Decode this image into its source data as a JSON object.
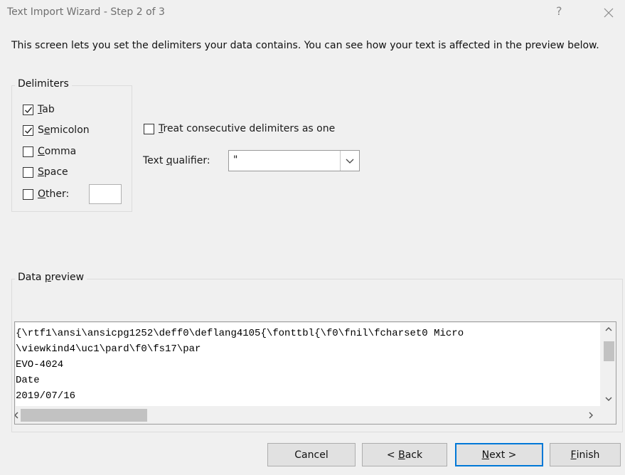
{
  "window": {
    "title": "Text Import Wizard - Step 2 of 3",
    "help_glyph": "?"
  },
  "description": "This screen lets you set the delimiters your data contains.  You can see how your text is affected in the preview below.",
  "delimiters": {
    "legend": "Delimiters",
    "items": [
      {
        "key": "T",
        "rest": "ab",
        "checked": true
      },
      {
        "key": "",
        "pre": "S",
        "mid": "e",
        "rest": "micolon",
        "checked": true
      },
      {
        "key": "C",
        "rest": "omma",
        "checked": false
      },
      {
        "key": "S",
        "rest": "pace",
        "checked": false
      },
      {
        "key": "O",
        "rest": "ther:",
        "checked": false
      }
    ],
    "other_value": ""
  },
  "treat_consecutive": {
    "pre": "",
    "key": "T",
    "rest": "reat consecutive delimiters as one",
    "checked": false
  },
  "text_qualifier": {
    "label_pre": "Text ",
    "label_key": "q",
    "label_rest": "ualifier:",
    "value": "\""
  },
  "preview": {
    "legend_pre": "Data ",
    "legend_key": "p",
    "legend_rest": "review",
    "lines": [
      "{\\rtf1\\ansi\\ansicpg1252\\deff0\\deflang4105{\\fonttbl{\\f0\\fnil\\fcharset0 Micro",
      "\\viewkind4\\uc1\\pard\\f0\\fs17\\par",
      "EVO-4024",
      "Date",
      "2019/07/16"
    ]
  },
  "buttons": {
    "cancel": "Cancel",
    "back_pre": "< ",
    "back_key": "B",
    "back_rest": "ack",
    "next_key": "N",
    "next_rest": "ext >",
    "finish_key": "F",
    "finish_rest": "inish"
  }
}
